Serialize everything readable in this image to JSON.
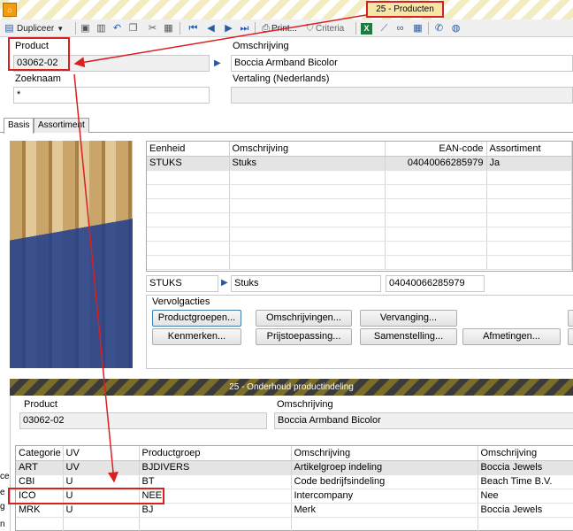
{
  "titlebar": {
    "title": "25 - Producten"
  },
  "toolbar": {
    "dupliceer_label": "Dupliceer",
    "print_label": "Print...",
    "criteria_label": "Criteria"
  },
  "header": {
    "product_label": "Product",
    "product_value": "03062-02",
    "omschrijving_label": "Omschrijving",
    "omschrijving_value": "Boccia Armband Bicolor",
    "zoeknaam_label": "Zoeknaam",
    "zoeknaam_value": "*",
    "vertaling_label": "Vertaling (Nederlands)",
    "vertaling_value": ""
  },
  "tabs": [
    {
      "label": "Basis"
    },
    {
      "label": "Assortiment"
    }
  ],
  "units_grid": {
    "columns": [
      "Eenheid",
      "Omschrijving",
      "EAN-code",
      "Assortiment"
    ],
    "rows": [
      [
        "STUKS",
        "Stuks",
        "04040066285979",
        "Ja"
      ]
    ]
  },
  "units_editor": {
    "eenheid": "STUKS",
    "omschrijving": "Stuks",
    "ean": "04040066285979"
  },
  "followups": {
    "title": "Vervolgacties",
    "buttons": [
      "Productgroepen...",
      "Omschrijvingen...",
      "Vervanging...",
      "Kenmerken...",
      "Prijstoepassing...",
      "Samenstelling...",
      "Afmetingen..."
    ]
  },
  "sub_window": {
    "title": "25 - Onderhoud productindeling",
    "product_label": "Product",
    "product_value": "03062-02",
    "omschrijving_label": "Omschrijving",
    "omschrijving_value": "Boccia Armband Bicolor",
    "columns": [
      "Categorie",
      "UV",
      "Productgroep",
      "Omschrijving",
      "Omschrijving"
    ],
    "rows": [
      [
        "ART",
        "UV",
        "BJDIVERS",
        "Artikelgroep indeling",
        "Boccia Jewels"
      ],
      [
        "CBI",
        "U",
        "BT",
        "Code bedrijfsindeling",
        "Beach Time B.V."
      ],
      [
        "ICO",
        "U",
        "NEE",
        "Intercompany",
        "Nee"
      ],
      [
        "MRK",
        "U",
        "BJ",
        "Merk",
        "Boccia Jewels"
      ]
    ]
  },
  "sidebar_fragments": [
    "ce",
    "e",
    "g",
    "n"
  ]
}
